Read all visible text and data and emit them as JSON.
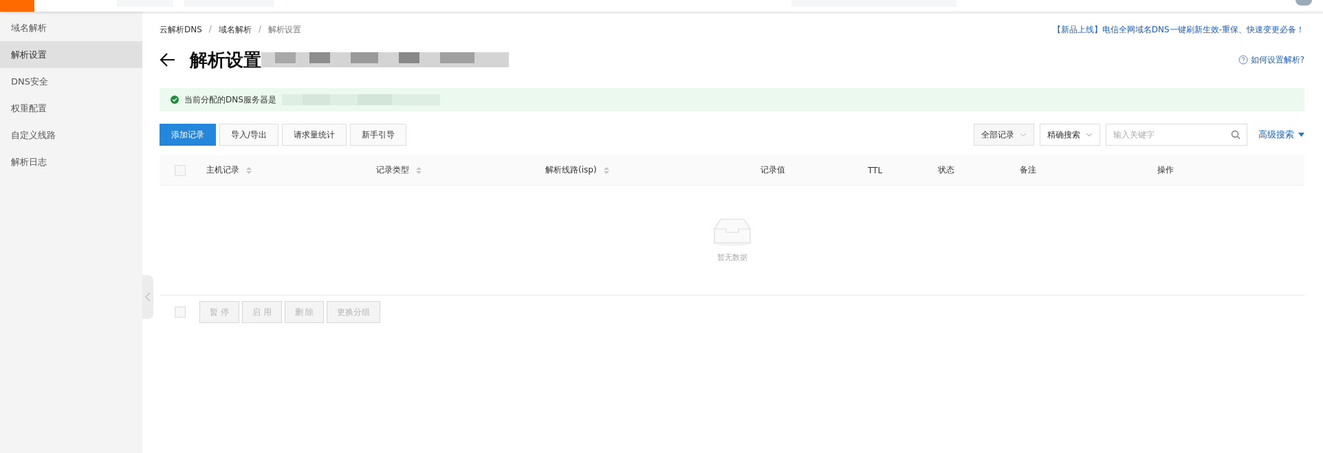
{
  "sidebar": {
    "items": [
      {
        "label": "域名解析",
        "selected": false
      },
      {
        "label": "解析设置",
        "selected": true
      },
      {
        "label": "DNS安全",
        "selected": false
      },
      {
        "label": "权重配置",
        "selected": false
      },
      {
        "label": "自定义线路",
        "selected": false
      },
      {
        "label": "解析日志",
        "selected": false
      }
    ]
  },
  "breadcrumb": {
    "separator": "/",
    "items": [
      "云解析DNS",
      "域名解析",
      "解析设置"
    ]
  },
  "promo_link": "【新品上线】电信全网域名DNS一键刷新生效-重保、快速变更必备！",
  "title": "解析设置",
  "help_link": "如何设置解析?",
  "alert": {
    "text": "当前分配的DNS服务器是"
  },
  "toolbar": [
    {
      "label": "添加记录",
      "kind": "primary"
    },
    {
      "label": "导入/导出",
      "kind": "default"
    },
    {
      "label": "请求量统计",
      "kind": "default"
    },
    {
      "label": "新手引导",
      "kind": "default"
    }
  ],
  "filters": {
    "record_scope": "全部记录",
    "match_mode": "精确搜索",
    "search": {
      "placeholder": "输入关键字"
    },
    "advanced": "高级搜索"
  },
  "table": {
    "header_checkbox": {
      "checked": false
    },
    "columns": [
      {
        "label": "主机记录",
        "sortable": true
      },
      {
        "label": "记录类型",
        "sortable": true
      },
      {
        "label": "解析线路(isp)",
        "sortable": true
      },
      {
        "label": "记录值",
        "sortable": false
      },
      {
        "label": "TTL",
        "sortable": false
      },
      {
        "label": "状态",
        "sortable": false
      },
      {
        "label": "备注",
        "sortable": false
      },
      {
        "label": "操作",
        "sortable": false
      }
    ],
    "empty_text": "暂无数据"
  },
  "bulk_checkbox": {
    "checked": false
  },
  "bulk_actions": [
    {
      "label": "暂 停",
      "disabled": true
    },
    {
      "label": "启 用",
      "disabled": true
    },
    {
      "label": "删 除",
      "disabled": true
    },
    {
      "label": "更换分组",
      "disabled": true
    }
  ]
}
